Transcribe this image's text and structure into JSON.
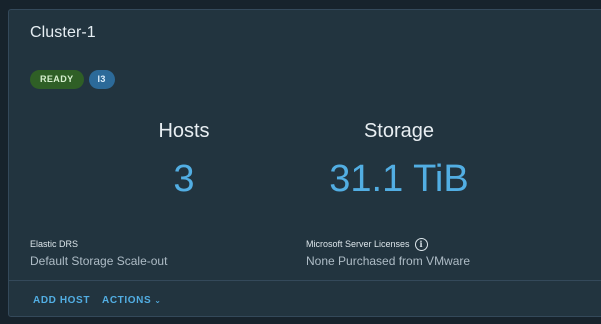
{
  "cluster": {
    "title": "Cluster-1",
    "badges": {
      "status": "READY",
      "instance_type": "I3"
    }
  },
  "stats": {
    "hosts": {
      "label": "Hosts",
      "value": "3"
    },
    "storage": {
      "label": "Storage",
      "value": "31.1 TiB"
    }
  },
  "info": {
    "elastic_drs": {
      "title": "Elastic DRS",
      "value": "Default Storage Scale-out"
    },
    "licenses": {
      "title": "Microsoft Server Licenses",
      "value": "None Purchased from VMware",
      "icon": "info-icon"
    }
  },
  "footer": {
    "add_host_label": "ADD HOST",
    "actions_label": "ACTIONS"
  },
  "colors": {
    "accent": "#52aee3",
    "ready_badge": "#2f5f26",
    "type_badge": "#2c6a99",
    "card_bg": "#22343f"
  }
}
